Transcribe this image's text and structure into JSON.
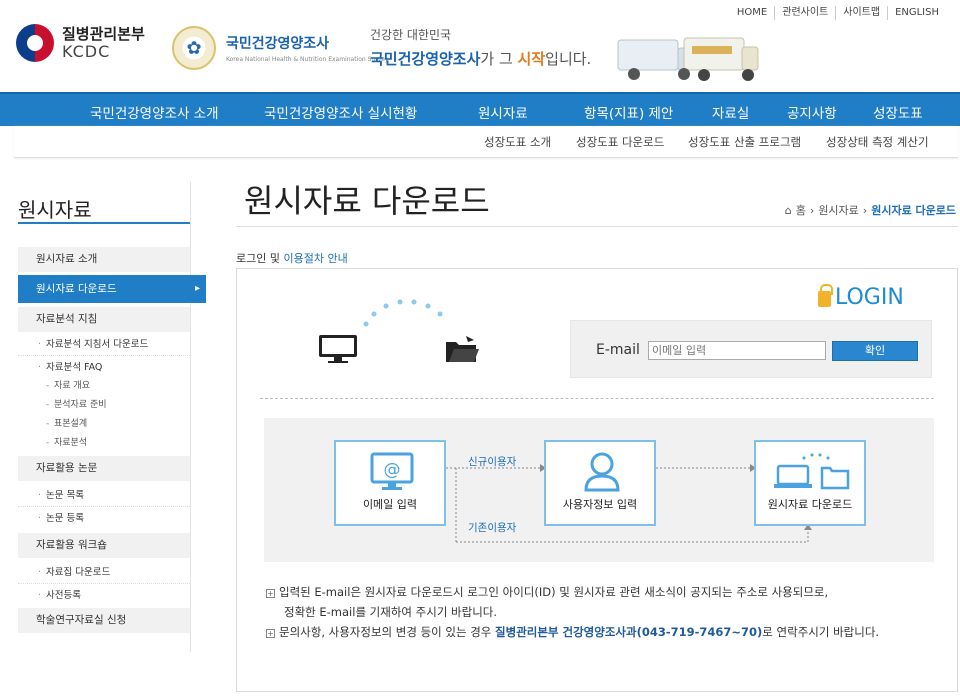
{
  "util_nav": [
    "HOME",
    "관련사이트",
    "사이트맵",
    "ENGLISH"
  ],
  "header": {
    "kcdc_name": "질병관리본부",
    "kcdc_abbr": "KCDC",
    "survey_name": "국민건강영양조사",
    "survey_sub": "Korea National Health & Nutrition Examination Survey",
    "slogan_line1": "건강한 대한민국",
    "slogan_strong": "국민건강영양조사",
    "slogan_mid": "가 그 ",
    "slogan_accent": "시작",
    "slogan_end": "입니다."
  },
  "gnb": [
    "국민건강영양조사 소개",
    "국민건강영양조사 실시현황",
    "원시자료",
    "항목(지표) 제안",
    "자료실",
    "공지사항",
    "성장도표"
  ],
  "subnav": [
    "성장도표 소개",
    "성장도표 다운로드",
    "성장도표 산출 프로그램",
    "성장상태 측정 계산기"
  ],
  "sidebar": {
    "title": "원시자료",
    "items": [
      {
        "label": "원시자료 소개"
      },
      {
        "label": "원시자료 다운로드"
      },
      {
        "label": "자료분석 지침"
      },
      {
        "label": "자료분석 지침서 다운로드"
      },
      {
        "label": "자료분석 FAQ"
      },
      {
        "label": "자료 개요"
      },
      {
        "label": "분석자료 준비"
      },
      {
        "label": "표본설계"
      },
      {
        "label": "자료분석"
      },
      {
        "label": "자료활용 논문"
      },
      {
        "label": "논문 목록"
      },
      {
        "label": "논문 등록"
      },
      {
        "label": "자료활용 워크숍"
      },
      {
        "label": "자료집 다운로드"
      },
      {
        "label": "사전등록"
      },
      {
        "label": "학술연구자료실 신청"
      }
    ]
  },
  "page_title": "원시자료 다운로드",
  "breadcrumb": [
    "홈",
    "원시자료",
    "원시자료 다운로드"
  ],
  "notice": {
    "prefix": "로그인 및 ",
    "link": "이용절차 안내"
  },
  "login": {
    "title": "LOGIN",
    "email_label": "E-mail",
    "email_placeholder": "이메일 입력",
    "confirm_label": "확인"
  },
  "flow": {
    "step1": "이메일 입력",
    "step2": "사용자정보 입력",
    "step3": "원시자료 다운로드",
    "new_user": "신규이용자",
    "existing_user": "기존이용자"
  },
  "notes": {
    "line1": "입력된 E-mail은 원시자료 다운로드시 로그인 아이디(ID) 및 원시자료 관련 새소식이 공지되는 주소로 사용되므로,",
    "line2": "정확한 E-mail를 기재하여 주시기 바랍니다.",
    "line3_prefix": "문의사항, 사용자정보의 변경 등이 있는 경우 ",
    "line3_strong": "질병관리본부 건강영양조사과(043-719-7467~70)",
    "line3_suffix": "로 연락주시기 바랍니다."
  },
  "colors": {
    "primary": "#1f7ec5",
    "accent": "#e07a1f",
    "login": "#1f8ad6"
  }
}
